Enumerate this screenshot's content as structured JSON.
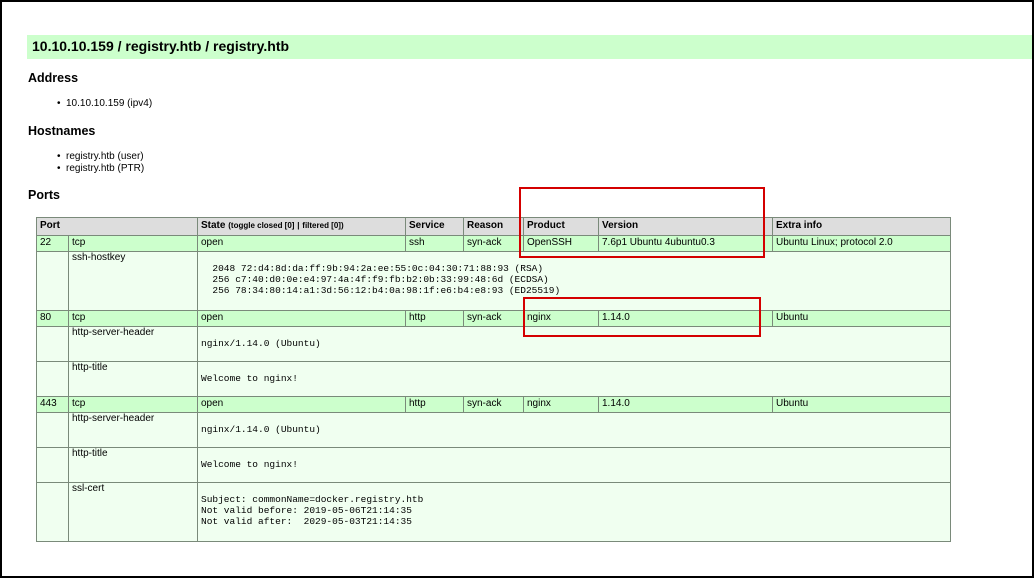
{
  "host": {
    "title": "10.10.10.159 / registry.htb / registry.htb"
  },
  "address": {
    "heading": "Address",
    "items": [
      "10.10.10.159 (ipv4)"
    ]
  },
  "hostnames": {
    "heading": "Hostnames",
    "items": [
      "registry.htb (user)",
      "registry.htb (PTR)"
    ]
  },
  "ports": {
    "heading": "Ports",
    "columns": {
      "port": "Port",
      "state": "State",
      "toggle_closed": "(toggle closed [0]",
      "sep": "|",
      "toggle_filtered": "filtered [0])",
      "service": "Service",
      "reason": "Reason",
      "product": "Product",
      "version": "Version",
      "extra": "Extra info"
    },
    "rows": [
      {
        "port": "22",
        "proto": "tcp",
        "state": "open",
        "service": "ssh",
        "reason": "syn-ack",
        "product": "OpenSSH",
        "version": "7.6p1 Ubuntu 4ubuntu0.3",
        "extra": "Ubuntu Linux; protocol 2.0",
        "scripts": [
          {
            "name": "ssh-hostkey",
            "output": "\n  2048 72:d4:8d:da:ff:9b:94:2a:ee:55:0c:04:30:71:88:93 (RSA)\n  256 c7:40:d0:0e:e4:97:4a:4f:f9:fb:b2:0b:33:99:48:6d (ECDSA)\n  256 78:34:80:14:a1:3d:56:12:b4:0a:98:1f:e6:b4:e8:93 (ED25519)"
          }
        ]
      },
      {
        "port": "80",
        "proto": "tcp",
        "state": "open",
        "service": "http",
        "reason": "syn-ack",
        "product": "nginx",
        "version": "1.14.0",
        "extra": "Ubuntu",
        "scripts": [
          {
            "name": "http-server-header",
            "output": "\nnginx/1.14.0 (Ubuntu)"
          },
          {
            "name": "http-title",
            "output": "\nWelcome to nginx!"
          }
        ]
      },
      {
        "port": "443",
        "proto": "tcp",
        "state": "open",
        "service": "http",
        "reason": "syn-ack",
        "product": "nginx",
        "version": "1.14.0",
        "extra": "Ubuntu",
        "scripts": [
          {
            "name": "http-server-header",
            "output": "\nnginx/1.14.0 (Ubuntu)"
          },
          {
            "name": "http-title",
            "output": "\nWelcome to nginx!"
          },
          {
            "name": "ssl-cert",
            "output": "\nSubject: commonName=docker.registry.htb\nNot valid before: 2019-05-06T21:14:35\nNot valid after:  2029-05-03T21:14:35"
          }
        ]
      }
    ]
  },
  "colors": {
    "header_bg": "#ccffcc",
    "open_row_bg": "#ccffcc",
    "script_row_bg": "#f0fff0",
    "table_header_bg": "#dddddd",
    "highlight_box": "#d40000"
  }
}
